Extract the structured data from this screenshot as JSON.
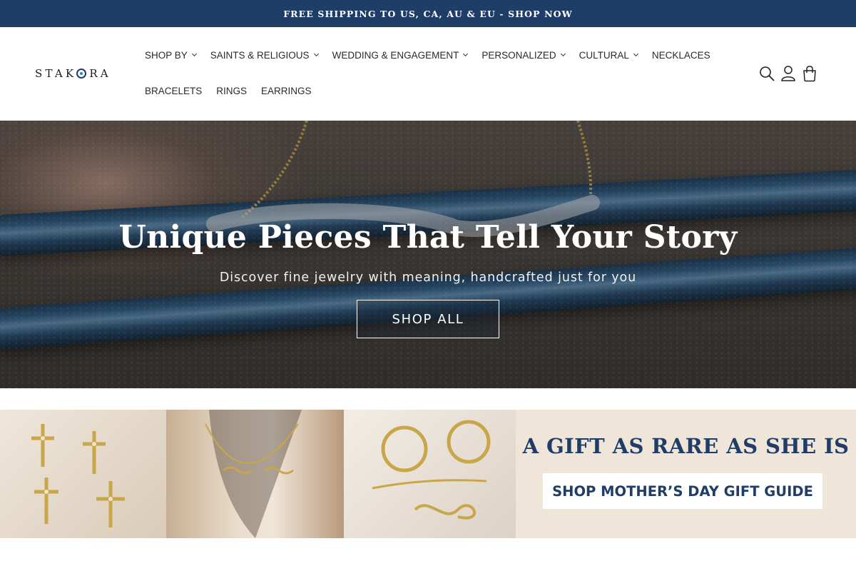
{
  "announcement": {
    "text": "FREE SHIPPING TO US, CA, AU & EU - SHOP NOW"
  },
  "header": {
    "logo_text_left": "STAK",
    "logo_text_right": "RA",
    "nav_row1": [
      {
        "label": "SHOP BY",
        "has_dropdown": true
      },
      {
        "label": "SAINTS & RELIGIOUS",
        "has_dropdown": true
      },
      {
        "label": "WEDDING & ENGAGEMENT",
        "has_dropdown": true
      },
      {
        "label": "PERSONALIZED",
        "has_dropdown": true
      },
      {
        "label": "CULTURAL",
        "has_dropdown": true
      },
      {
        "label": "NECKLACES",
        "has_dropdown": false
      }
    ],
    "nav_row2": [
      {
        "label": "BRACELETS",
        "has_dropdown": false
      },
      {
        "label": "RINGS",
        "has_dropdown": false
      },
      {
        "label": "EARRINGS",
        "has_dropdown": false
      }
    ],
    "icons": [
      "search-icon",
      "account-icon",
      "cart-icon"
    ]
  },
  "hero": {
    "title": "Unique Pieces That Tell Your Story",
    "subtitle": "Discover fine jewelry with meaning, handcrafted just for you",
    "button_label": "SHOP ALL"
  },
  "promo": {
    "headline": "A GIFT AS RARE AS SHE IS",
    "button_label": "SHOP MOTHER’S DAY GIFT GUIDE"
  },
  "colors": {
    "brand_navy": "#1f3d67",
    "promo_background": "#efe6d9",
    "jewelry_gold": "#c9a64a"
  }
}
